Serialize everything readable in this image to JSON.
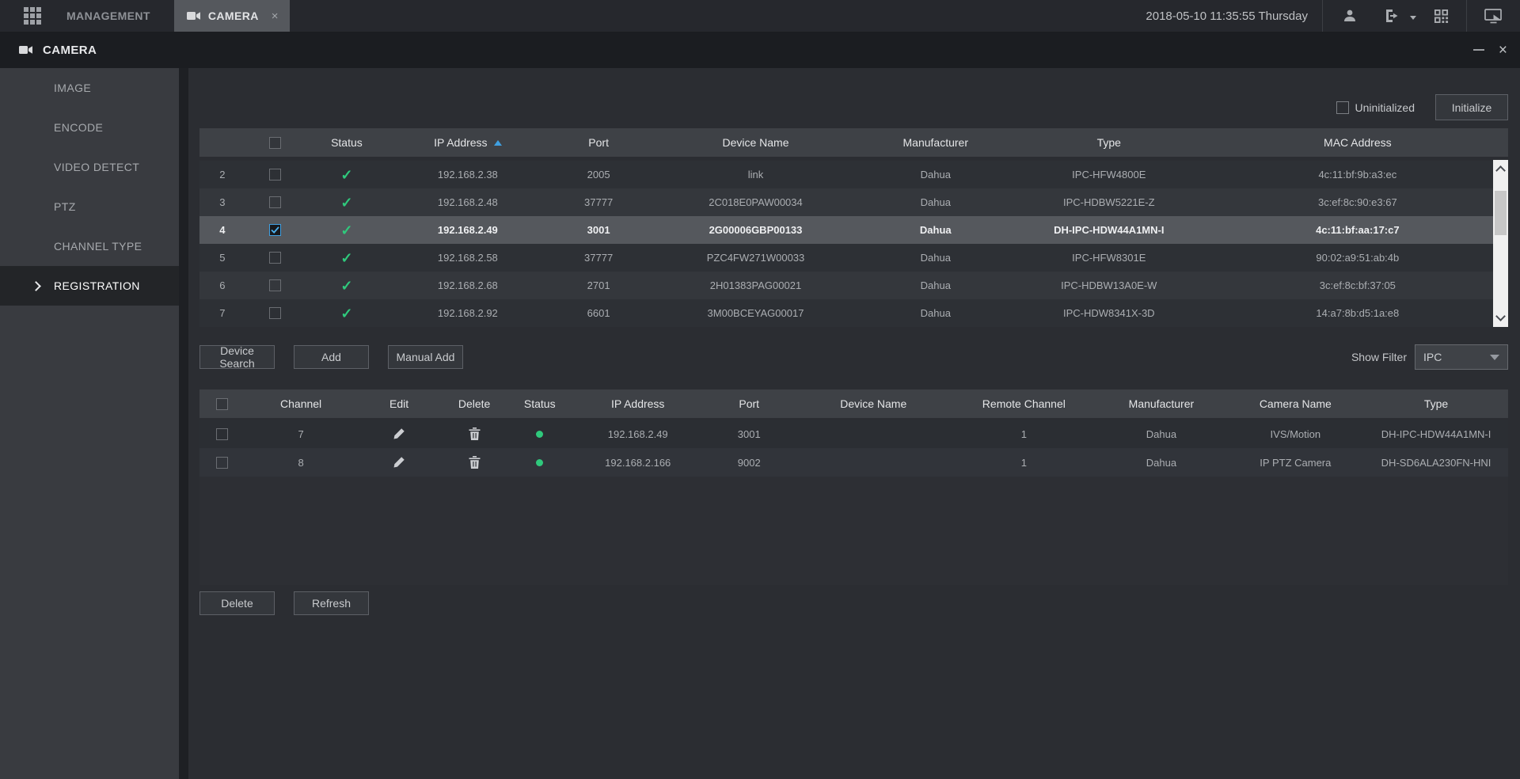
{
  "colors": {
    "accent_blue": "#3f9fe0",
    "success_green": "#2fc97c",
    "selected_row": "#55585d",
    "header_bg": "#3e4146"
  },
  "topbar": {
    "datetime": "2018-05-10 11:35:55 Thursday",
    "tabs": [
      {
        "label": "MANAGEMENT",
        "active": false
      },
      {
        "label": "CAMERA",
        "active": true
      }
    ]
  },
  "window": {
    "title": "CAMERA"
  },
  "sidebar": {
    "items": [
      {
        "label": "IMAGE",
        "active": false
      },
      {
        "label": "ENCODE",
        "active": false
      },
      {
        "label": "VIDEO DETECT",
        "active": false
      },
      {
        "label": "PTZ",
        "active": false
      },
      {
        "label": "CHANNEL TYPE",
        "active": false
      },
      {
        "label": "REGISTRATION",
        "active": true
      }
    ]
  },
  "init_bar": {
    "uninitialized_label": "Uninitialized",
    "initialize_label": "Initialize"
  },
  "device_table": {
    "headers": {
      "status": "Status",
      "ip": "IP Address",
      "port": "Port",
      "device_name": "Device Name",
      "manufacturer": "Manufacturer",
      "type": "Type",
      "mac": "MAC Address"
    },
    "sorted_by": "IP Address ascending",
    "rows": [
      {
        "index": "2",
        "checked": false,
        "online": true,
        "ip": "192.168.2.38",
        "port": "2005",
        "device_name": "link",
        "manufacturer": "Dahua",
        "type": "IPC-HFW4800E",
        "mac": "4c:11:bf:9b:a3:ec"
      },
      {
        "index": "3",
        "checked": false,
        "online": true,
        "ip": "192.168.2.48",
        "port": "37777",
        "device_name": "2C018E0PAW00034",
        "manufacturer": "Dahua",
        "type": "IPC-HDBW5221E-Z",
        "mac": "3c:ef:8c:90:e3:67"
      },
      {
        "index": "4",
        "checked": true,
        "online": true,
        "ip": "192.168.2.49",
        "port": "3001",
        "device_name": "2G00006GBP00133",
        "manufacturer": "Dahua",
        "type": "DH-IPC-HDW44A1MN-I",
        "mac": "4c:11:bf:aa:17:c7"
      },
      {
        "index": "5",
        "checked": false,
        "online": true,
        "ip": "192.168.2.58",
        "port": "37777",
        "device_name": "PZC4FW271W00033",
        "manufacturer": "Dahua",
        "type": "IPC-HFW8301E",
        "mac": "90:02:a9:51:ab:4b"
      },
      {
        "index": "6",
        "checked": false,
        "online": true,
        "ip": "192.168.2.68",
        "port": "2701",
        "device_name": "2H01383PAG00021",
        "manufacturer": "Dahua",
        "type": "IPC-HDBW13A0E-W",
        "mac": "3c:ef:8c:bf:37:05"
      },
      {
        "index": "7",
        "checked": false,
        "online": true,
        "ip": "192.168.2.92",
        "port": "6601",
        "device_name": "3M00BCEYAG00017",
        "manufacturer": "Dahua",
        "type": "IPC-HDW8341X-3D",
        "mac": "14:a7:8b:d5:1a:e8"
      }
    ]
  },
  "actions": {
    "device_search": "Device Search",
    "add": "Add",
    "manual_add": "Manual Add",
    "show_filter_label": "Show Filter",
    "show_filter_value": "IPC"
  },
  "added_table": {
    "headers": {
      "channel": "Channel",
      "edit": "Edit",
      "delete": "Delete",
      "status": "Status",
      "ip": "IP Address",
      "port": "Port",
      "device_name": "Device Name",
      "remote_channel": "Remote Channel",
      "manufacturer": "Manufacturer",
      "camera_name": "Camera Name",
      "type": "Type"
    },
    "rows": [
      {
        "channel": "7",
        "connected": true,
        "ip": "192.168.2.49",
        "port": "3001",
        "device_name": "",
        "remote_channel": "1",
        "manufacturer": "Dahua",
        "camera_name": "IVS/Motion",
        "type": "DH-IPC-HDW44A1MN-I"
      },
      {
        "channel": "8",
        "connected": true,
        "ip": "192.168.2.166",
        "port": "9002",
        "device_name": "",
        "remote_channel": "1",
        "manufacturer": "Dahua",
        "camera_name": "IP PTZ Camera",
        "type": "DH-SD6ALA230FN-HNI"
      }
    ]
  },
  "footer": {
    "delete_label": "Delete",
    "refresh_label": "Refresh"
  }
}
